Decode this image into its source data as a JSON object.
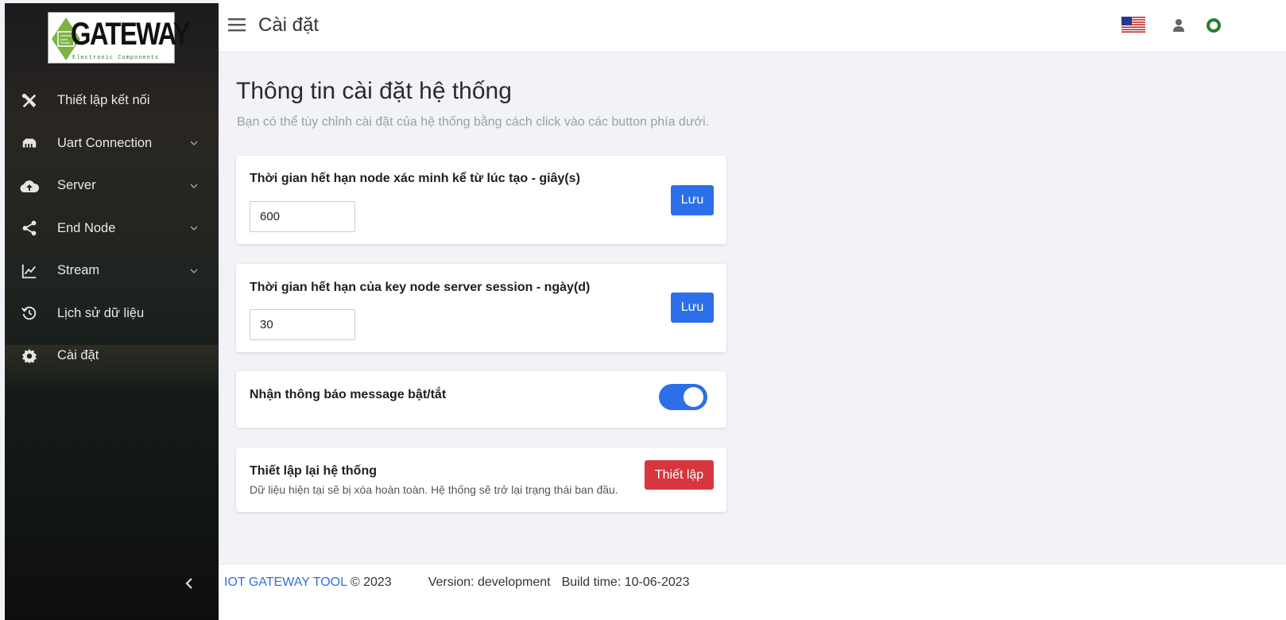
{
  "app": {
    "logo_text": "GATEWAY",
    "logo_subtext": "Electronic Components"
  },
  "sidebar": {
    "items": [
      {
        "label": "Thiết lập kết nối",
        "icon": "tools-icon",
        "has_chevron": false
      },
      {
        "label": "Uart Connection",
        "icon": "ethernet-icon",
        "has_chevron": true
      },
      {
        "label": "Server",
        "icon": "cloud-upload-icon",
        "has_chevron": true
      },
      {
        "label": "End Node",
        "icon": "share-icon",
        "has_chevron": true
      },
      {
        "label": "Stream",
        "icon": "line-chart-icon",
        "has_chevron": true
      },
      {
        "label": "Lịch sử dữ liệu",
        "icon": "history-icon",
        "has_chevron": false
      },
      {
        "label": "Cài đặt",
        "icon": "gear-icon",
        "has_chevron": false
      }
    ]
  },
  "header": {
    "title": "Cài đặt",
    "language_icon": "us-flag-icon",
    "user_icon": "user-icon",
    "status_icon": "online-status-icon"
  },
  "main": {
    "title": "Thông tin cài đặt hệ thống",
    "subtitle": "Bạn có thể tùy chỉnh cài đặt của hệ thống bằng cách click vào các button phía dưới.",
    "cards": {
      "node_expire": {
        "title": "Thời gian hết hạn node xác minh kể từ lúc tạo - giây(s)",
        "value": "600",
        "button": "Lưu"
      },
      "key_expire": {
        "title": "Thời gian hết hạn của key node server session - ngày(d)",
        "value": "30",
        "button": "Lưu"
      },
      "notification": {
        "title": "Nhận thông báo message bật/tắt",
        "enabled": true
      },
      "reset": {
        "title": "Thiết lập lại hệ thống",
        "description": "Dữ liệu hiện tại sẽ bị xóa hoàn toàn. Hệ thống sẽ trở lại trạng thái ban đầu.",
        "button": "Thiết lập"
      }
    }
  },
  "footer": {
    "brand": "IOT GATEWAY TOOL",
    "copyright": "© 2023",
    "version": "Version: development",
    "build_time": "Build time: 10-06-2023"
  },
  "colors": {
    "primary": "#2d6fe8",
    "danger": "#d7363f",
    "status_online": "#2e7d32",
    "logo_green": "#7cb342"
  }
}
